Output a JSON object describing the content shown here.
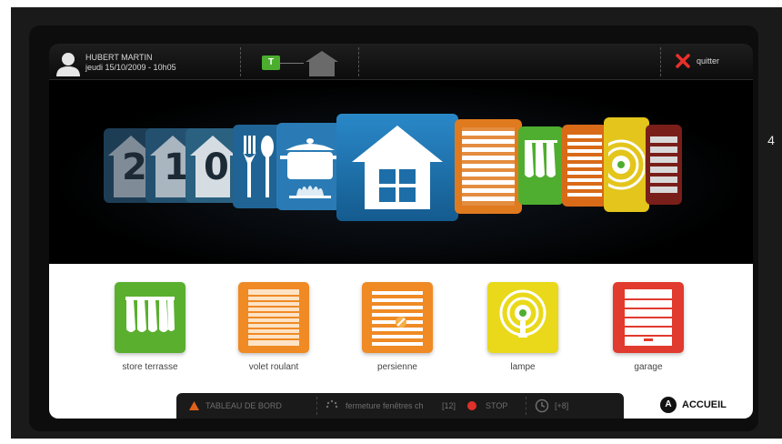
{
  "header": {
    "user_name": "HUBERT MARTIN",
    "date_time": "jeudi 15/10/2009 - 10h05",
    "mode_badge": "T",
    "quit_label": "quitter"
  },
  "carousel": {
    "items": [
      {
        "name": "house-2",
        "number": "2",
        "color": "#7f8c98"
      },
      {
        "name": "house-1",
        "number": "1",
        "color": "#9aa6b0"
      },
      {
        "name": "house-0",
        "number": "0",
        "color": "#c9d3db"
      },
      {
        "name": "cutlery",
        "color": "#2a6f9e"
      },
      {
        "name": "cooking-pot",
        "color": "#3a85b8"
      },
      {
        "name": "home-selected",
        "color": "#1f6fa8"
      },
      {
        "name": "roller-shutter",
        "color": "#e07a1f"
      },
      {
        "name": "awning",
        "color": "#4fae2f"
      },
      {
        "name": "shutter",
        "color": "#e0781c"
      },
      {
        "name": "lamp",
        "color": "#e8d020"
      },
      {
        "name": "garage",
        "color": "#c0302a"
      }
    ]
  },
  "side_number": "4",
  "devices": [
    {
      "label": "store terrasse",
      "icon": "awning-icon",
      "color": "#5aaf2f"
    },
    {
      "label": "volet roulant",
      "icon": "roller-shutter-icon",
      "color": "#ef8a24"
    },
    {
      "label": "persienne",
      "icon": "shutter-icon",
      "color": "#ef8a24"
    },
    {
      "label": "lampe",
      "icon": "lamp-icon",
      "color": "#e9d91a"
    },
    {
      "label": "garage",
      "icon": "garage-icon",
      "color": "#e13a2e"
    }
  ],
  "statusbar": {
    "dashboard": "TABLEAU DE BORD",
    "closing": "fermeture fenêtres ch",
    "closing_count": "[12]",
    "stop": "STOP",
    "timer": "[+8]"
  },
  "home": {
    "icon_letter": "A",
    "label": "ACCUEIL"
  }
}
